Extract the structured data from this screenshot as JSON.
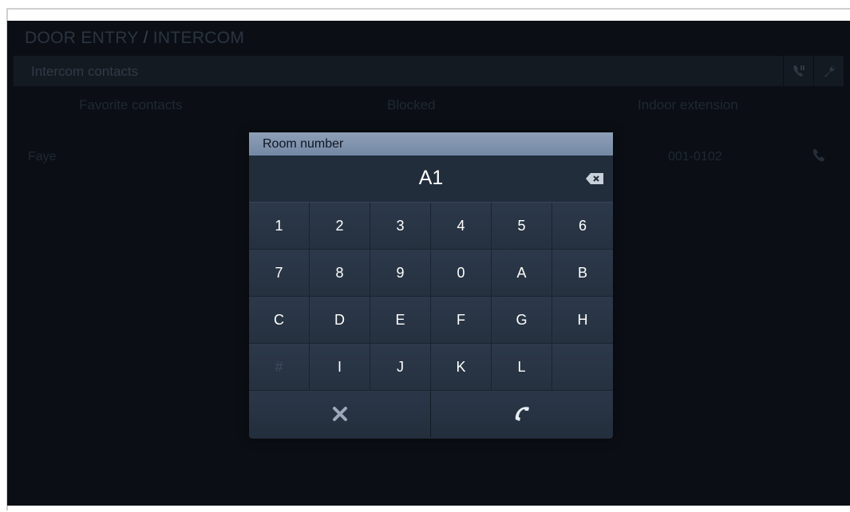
{
  "app": {
    "title_left": "DOOR ENTRY",
    "title_separator": "/",
    "title_right": "INTERCOM"
  },
  "header": {
    "title": "Intercom contacts",
    "icons": [
      "phone-list-icon",
      "wrench-icon"
    ]
  },
  "tabs": [
    {
      "label": "Favorite contacts"
    },
    {
      "label": "Blocked"
    },
    {
      "label": "Indoor extension"
    }
  ],
  "contacts": [
    {
      "name": "Faye",
      "extension": "001-0102",
      "icon": "phone-icon"
    }
  ],
  "dialog": {
    "title": "Room number",
    "value": "A1",
    "keys": [
      "1",
      "2",
      "3",
      "4",
      "5",
      "6",
      "7",
      "8",
      "9",
      "0",
      "A",
      "B",
      "C",
      "D",
      "E",
      "F",
      "G",
      "H",
      "#",
      "I",
      "J",
      "K",
      "L",
      ""
    ],
    "cancel_icon": "close-icon",
    "call_icon": "handset-icon",
    "backspace_icon": "backspace-icon"
  },
  "colors": {
    "screen_bg": "#0b0f15",
    "dialog_bg": "#222d3c",
    "dialog_title_bg": "#7f93ae",
    "key_text": "#ffffff"
  }
}
